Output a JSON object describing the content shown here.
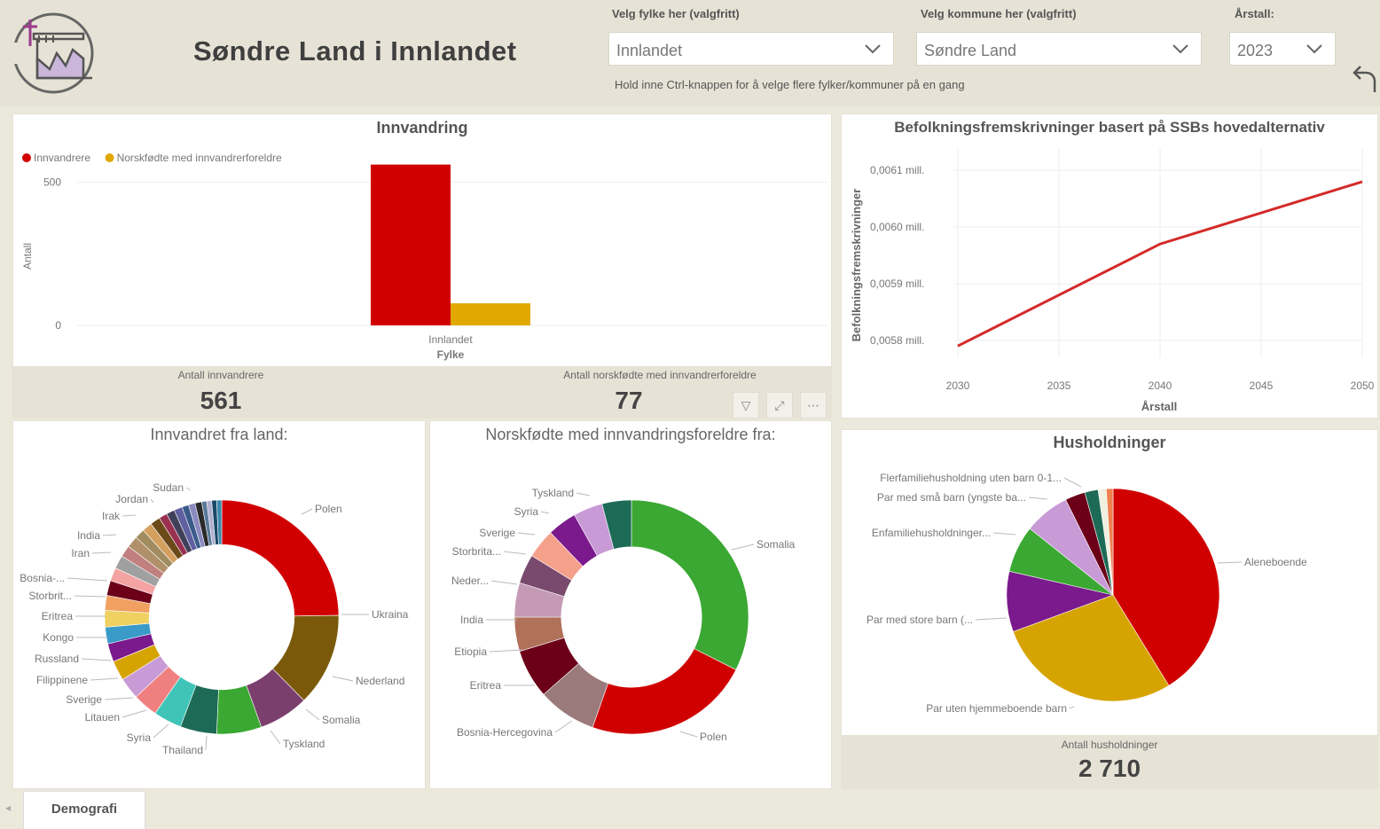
{
  "header": {
    "title": "Søndre Land i Innlandet",
    "county_label": "Velg fylke her (valgfritt)",
    "county_value": "Innlandet",
    "municipality_label": "Velg kommune her (valgfritt)",
    "municipality_value": "Søndre Land",
    "year_label": "Årstall:",
    "year_value": "2023",
    "hint": "Hold inne Ctrl-knappen for å velge flere fylker/kommuner på en gang"
  },
  "immigration": {
    "title": "Innvandring",
    "kpi1_label": "Antall innvandrere",
    "kpi1_value": "561",
    "kpi2_label": "Antall norskfødte med innvandrerforeldre",
    "kpi2_value": "77"
  },
  "projection": {
    "title": "Befolkningsfremskrivninger basert på SSBs hovedalternativ"
  },
  "immigrant_countries": {
    "title": "Innvandret fra land:"
  },
  "norwegian_born": {
    "title": "Norskfødte med innvandringsforeldre fra:"
  },
  "households": {
    "title": "Husholdninger",
    "kpi_label": "Antall husholdninger",
    "kpi_value": "2 710"
  },
  "tabs": {
    "active": "Demografi"
  },
  "colors": {
    "red": "#d10000",
    "gold": "#e0a800",
    "line": "#d42a2a"
  },
  "chart_data": [
    {
      "type": "bar",
      "title": "Innvandring",
      "categories": [
        "Innlandet"
      ],
      "series": [
        {
          "name": "Innvandrere",
          "values": [
            561
          ],
          "color": "#d10000"
        },
        {
          "name": "Norskfødte med innvandrerforeldre",
          "values": [
            77
          ],
          "color": "#e0a800"
        }
      ],
      "xlabel": "Fylke",
      "ylabel": "Antall",
      "yticks": [
        0,
        500
      ],
      "ylim": [
        0,
        600
      ],
      "legend": "top-left",
      "grid": true
    },
    {
      "type": "line",
      "title": "Befolkningsfremskrivninger basert på SSBs hovedalternativ",
      "x": [
        2030,
        2040,
        2050
      ],
      "y": [
        0.00579,
        0.00597,
        0.00608
      ],
      "xticks": [
        "2030",
        "2035",
        "2040",
        "2045",
        "2050"
      ],
      "yticks": [
        "0,0058 mill.",
        "0,0059 mill.",
        "0,0060 mill.",
        "0,0061 mill."
      ],
      "ylim": [
        0.00577,
        0.00613
      ],
      "xlim": [
        2030,
        2050
      ],
      "xlabel": "Årstall",
      "ylabel": "Befolkningsfremskrivninger",
      "color": "#d42a2a",
      "grid": true
    },
    {
      "type": "pie",
      "title": "Innvandret fra land:",
      "labels": [
        "Polen",
        "Ukraina",
        "Nederland",
        "Somalia",
        "Tyskland",
        "",
        "Thailand",
        "Syria",
        "Litauen",
        "Sverige",
        "Filippinene",
        "Russland",
        "Kongo",
        "Eritrea",
        "Storbrit...",
        "Bosnia-...",
        "",
        "Iran",
        "India",
        "",
        "Irak",
        "Jordan",
        "",
        "",
        "Sudan",
        "",
        "",
        "",
        "",
        "",
        ""
      ],
      "values": [
        108,
        56,
        30,
        27,
        22,
        17,
        15,
        13,
        12,
        11,
        10,
        10,
        9,
        9,
        8,
        8,
        7,
        7,
        6,
        6,
        6,
        5,
        5,
        5,
        4,
        4,
        4,
        3,
        3,
        3,
        3
      ],
      "colors": [
        "#d10000",
        "#7a5a0a",
        "#7b3f6e",
        "#3aa832",
        "#1d6b57",
        "#40c4b8",
        "#f08080",
        "#c89ad6",
        "#d6a400",
        "#7a1a8c",
        "#3a9ac8",
        "#f0d060",
        "#f0a060",
        "#6b0018",
        "#f4a3a3",
        "#a0a0a0",
        "#c08080",
        "#b0906a",
        "#a08c60",
        "#d4a060",
        "#6b4a1a",
        "#9a3050",
        "#40405a",
        "#6060a0",
        "#3a5a8a",
        "#8a8ac0",
        "#2a2a2a",
        "#5a7a9a",
        "#b0b0d0",
        "#1a4a6a",
        "#3a8aaa"
      ],
      "inner": 0.62
    },
    {
      "type": "pie",
      "title": "Norskfødte med innvandringsforeldre fra:",
      "labels": [
        "Somalia",
        "Polen",
        "Bosnia-Hercegovina",
        "Eritrea",
        "Etiopia",
        "India",
        "Neder...",
        "Storbrita...",
        "Sverige",
        "Syria",
        "Tyskland"
      ],
      "values": [
        24,
        17,
        6,
        5,
        3.5,
        3.5,
        3,
        3,
        3,
        3,
        3
      ],
      "colors": [
        "#3aa832",
        "#d10000",
        "#9a7a7a",
        "#6b0018",
        "#b0705a",
        "#c49ab4",
        "#7a4a6e",
        "#f4a08a",
        "#7a1a8c",
        "#c89ad6",
        "#1d6b57",
        "#7a5a1a"
      ],
      "inner": 0.6
    },
    {
      "type": "pie",
      "title": "Husholdninger",
      "labels": [
        "Aleneboende",
        "Par uten hjemmeboende barn",
        "Par med store barn (...",
        "Enfamiliehusholdninger...",
        "Par med små barn (yngste ba...",
        "Flerfamiliehusholdning uten barn 0-1...",
        "",
        "",
        ""
      ],
      "values": [
        40.4,
        27.6,
        9,
        7,
        6.8,
        3,
        2,
        1.2,
        1
      ],
      "colors": [
        "#d10000",
        "#d6a400",
        "#7a1a8c",
        "#3aa832",
        "#c89ad6",
        "#6b0018",
        "#1d6b57",
        "#f0f0e0",
        "#f08050"
      ],
      "inner": 0
    }
  ]
}
